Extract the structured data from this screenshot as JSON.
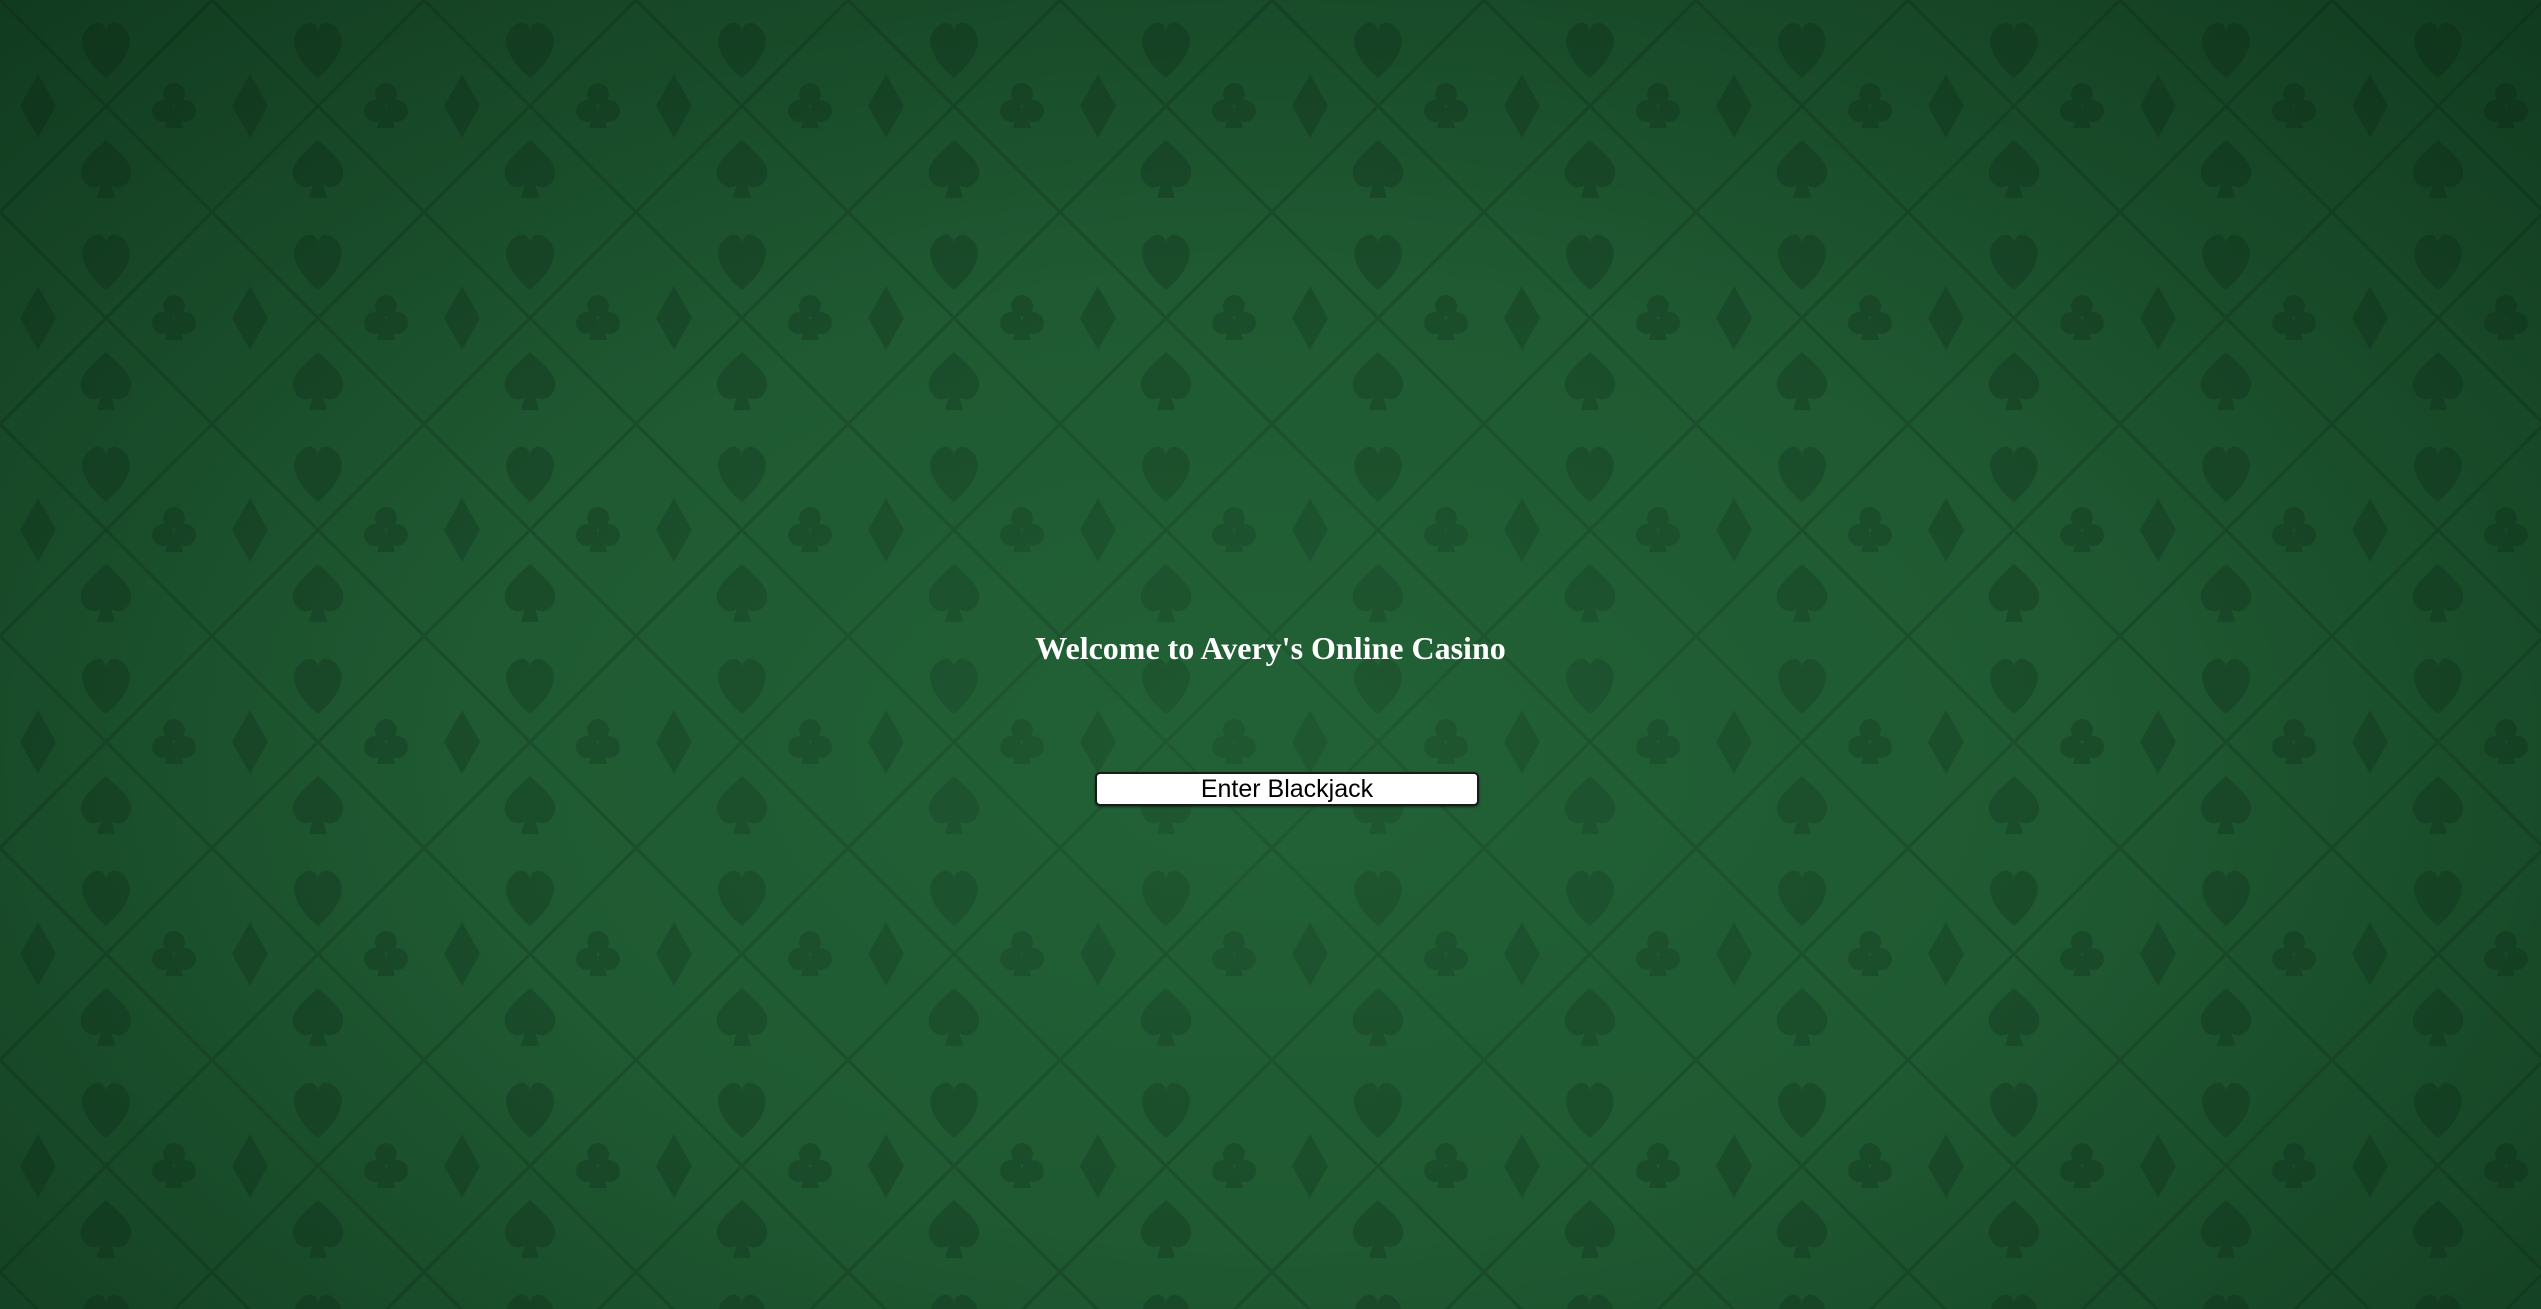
{
  "page": {
    "title": "Welcome to Avery's Online Casino",
    "background": {
      "pattern": "card-suits-felt",
      "icons": [
        "spade-icon",
        "heart-icon",
        "diamond-icon",
        "club-icon"
      ],
      "base_color": "#1f5a32",
      "suit_color": "#1a4a29"
    }
  },
  "actions": {
    "enter_blackjack_label": "Enter Blackjack"
  }
}
